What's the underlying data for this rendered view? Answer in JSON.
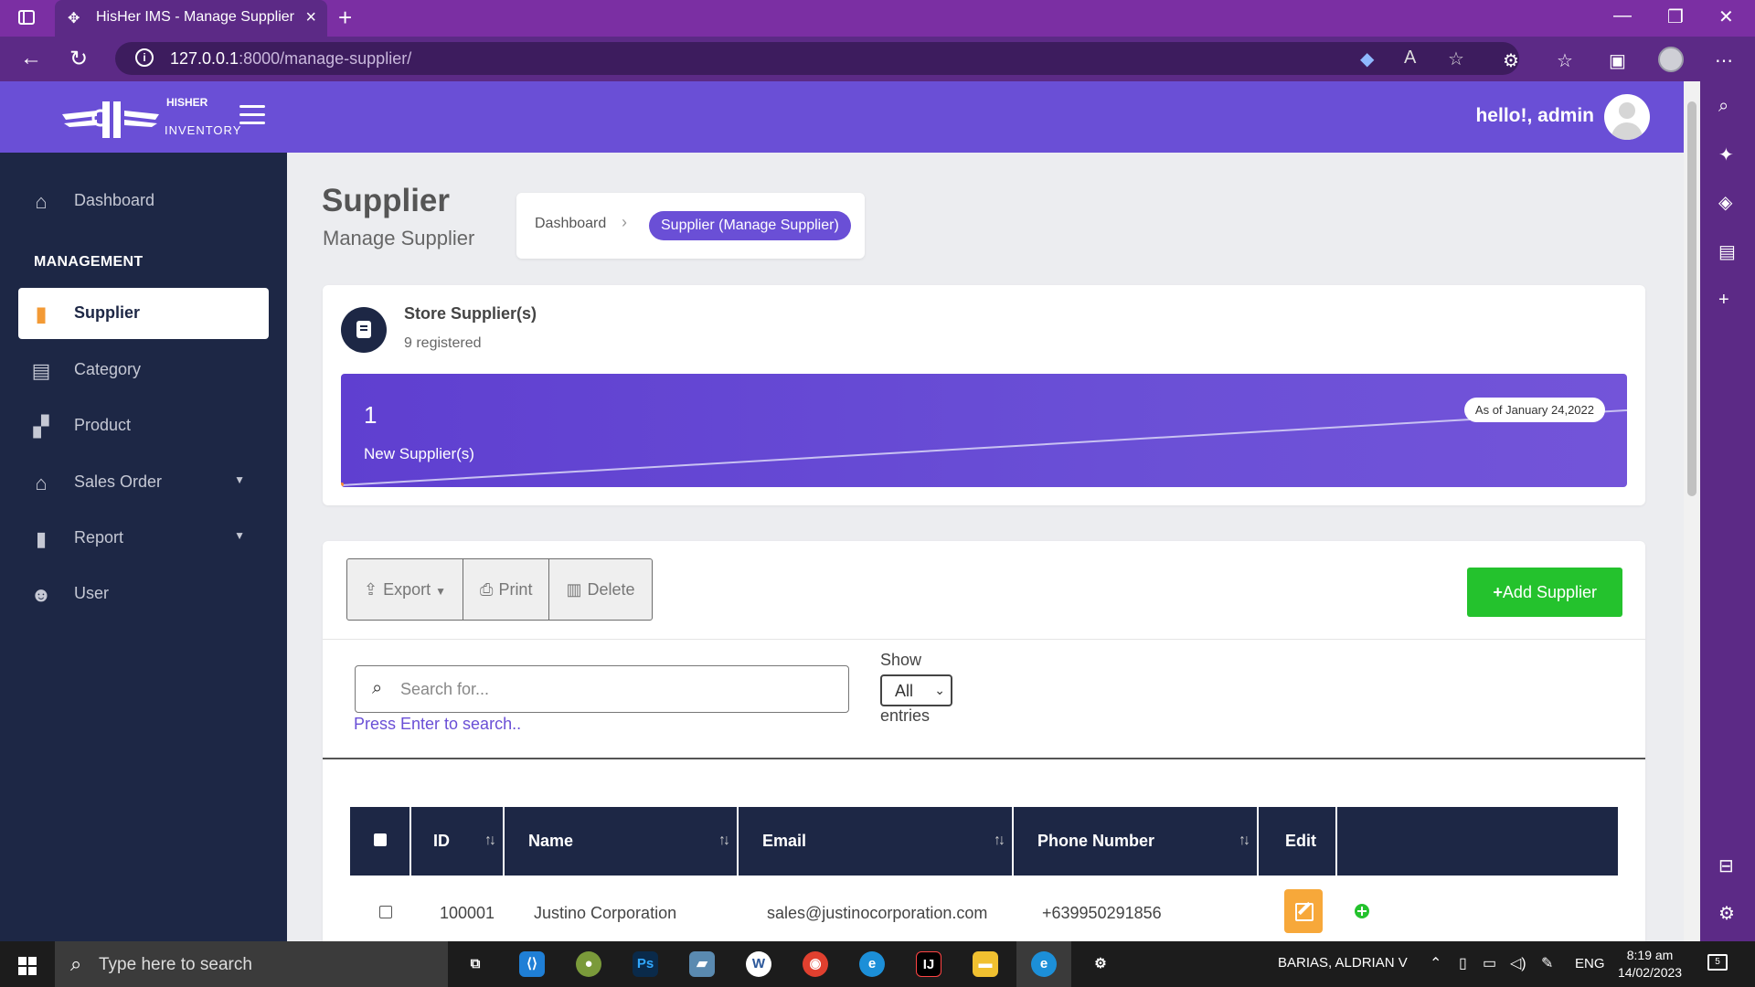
{
  "browser": {
    "tab_title": "HisHer IMS - Manage Supplier",
    "url_host": "127.0.0.1",
    "url_rest": ":8000/manage-supplier/"
  },
  "logo": {
    "top": "HISHER",
    "bottom": "INVENTORY"
  },
  "header": {
    "greeting": "hello!, admin"
  },
  "sidebar": {
    "section_heading": "MANAGEMENT",
    "items": [
      {
        "label": "Dashboard",
        "icon": "home-icon"
      },
      {
        "label": "Supplier",
        "icon": "supplier-icon",
        "active": true
      },
      {
        "label": "Category",
        "icon": "category-icon"
      },
      {
        "label": "Product",
        "icon": "product-icon"
      },
      {
        "label": "Sales Order",
        "icon": "cart-icon",
        "has_caret": true
      },
      {
        "label": "Report",
        "icon": "file-icon",
        "has_caret": true
      },
      {
        "label": "User",
        "icon": "users-icon"
      }
    ]
  },
  "page": {
    "title": "Supplier",
    "subtitle": "Manage Supplier"
  },
  "breadcrumb": {
    "home": "Dashboard",
    "current": "Supplier (Manage Supplier)"
  },
  "stats": {
    "title": "Store Supplier(s)",
    "subtitle": "9 registered",
    "count": "1",
    "count_label": "New Supplier(s)",
    "as_of": "As of January 24,2022"
  },
  "toolbar": {
    "export_label": "Export",
    "print_label": "Print",
    "delete_label": "Delete",
    "add_label": "Add Supplier"
  },
  "filters": {
    "search_placeholder": "Search for...",
    "search_hint": "Press Enter to search..",
    "show_label": "Show",
    "show_value": "All",
    "entries_label": "entries"
  },
  "table": {
    "columns": [
      "ID",
      "Name",
      "Email",
      "Phone Number",
      "Edit"
    ],
    "rows": [
      {
        "id": "100001",
        "name": "Justino Corporation",
        "email": "sales@justinocorporation.com",
        "phone": "+639950291856"
      }
    ]
  },
  "taskbar": {
    "search_text": "Type here to search",
    "user": "BARIAS, ALDRIAN V",
    "lang": "ENG",
    "time": "8:19 am",
    "date": "14/02/2023",
    "notifications": "5"
  },
  "colors": {
    "brand_purple": "#6a4fd6",
    "sidebar_navy": "#1d2745",
    "add_green": "#24c22d",
    "edit_orange": "#f7a83a",
    "browser_purple": "#7b2fa3"
  }
}
